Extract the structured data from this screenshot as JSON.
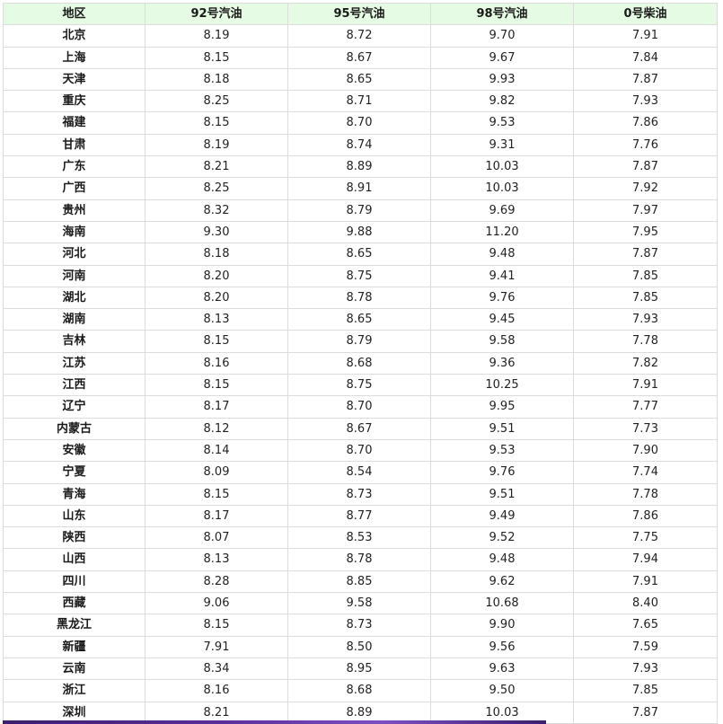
{
  "table": {
    "headers": [
      "地区",
      "92号汽油",
      "95号汽油",
      "98号汽油",
      "0号柴油"
    ],
    "rows": [
      [
        "北京",
        "8.19",
        "8.72",
        "9.70",
        "7.91"
      ],
      [
        "上海",
        "8.15",
        "8.67",
        "9.67",
        "7.84"
      ],
      [
        "天津",
        "8.18",
        "8.65",
        "9.93",
        "7.87"
      ],
      [
        "重庆",
        "8.25",
        "8.71",
        "9.82",
        "7.93"
      ],
      [
        "福建",
        "8.15",
        "8.70",
        "9.53",
        "7.86"
      ],
      [
        "甘肃",
        "8.19",
        "8.74",
        "9.31",
        "7.76"
      ],
      [
        "广东",
        "8.21",
        "8.89",
        "10.03",
        "7.87"
      ],
      [
        "广西",
        "8.25",
        "8.91",
        "10.03",
        "7.92"
      ],
      [
        "贵州",
        "8.32",
        "8.79",
        "9.69",
        "7.97"
      ],
      [
        "海南",
        "9.30",
        "9.88",
        "11.20",
        "7.95"
      ],
      [
        "河北",
        "8.18",
        "8.65",
        "9.48",
        "7.87"
      ],
      [
        "河南",
        "8.20",
        "8.75",
        "9.41",
        "7.85"
      ],
      [
        "湖北",
        "8.20",
        "8.78",
        "9.76",
        "7.85"
      ],
      [
        "湖南",
        "8.13",
        "8.65",
        "9.45",
        "7.93"
      ],
      [
        "吉林",
        "8.15",
        "8.79",
        "9.58",
        "7.78"
      ],
      [
        "江苏",
        "8.16",
        "8.68",
        "9.36",
        "7.82"
      ],
      [
        "江西",
        "8.15",
        "8.75",
        "10.25",
        "7.91"
      ],
      [
        "辽宁",
        "8.17",
        "8.70",
        "9.95",
        "7.77"
      ],
      [
        "内蒙古",
        "8.12",
        "8.67",
        "9.51",
        "7.73"
      ],
      [
        "安徽",
        "8.14",
        "8.70",
        "9.53",
        "7.90"
      ],
      [
        "宁夏",
        "8.09",
        "8.54",
        "9.76",
        "7.74"
      ],
      [
        "青海",
        "8.15",
        "8.73",
        "9.51",
        "7.78"
      ],
      [
        "山东",
        "8.17",
        "8.77",
        "9.49",
        "7.86"
      ],
      [
        "陕西",
        "8.07",
        "8.53",
        "9.52",
        "7.75"
      ],
      [
        "山西",
        "8.13",
        "8.78",
        "9.48",
        "7.94"
      ],
      [
        "四川",
        "8.28",
        "8.85",
        "9.62",
        "7.91"
      ],
      [
        "西藏",
        "9.06",
        "9.58",
        "10.68",
        "8.40"
      ],
      [
        "黑龙江",
        "8.15",
        "8.73",
        "9.90",
        "7.65"
      ],
      [
        "新疆",
        "7.91",
        "8.50",
        "9.56",
        "7.59"
      ],
      [
        "云南",
        "8.34",
        "8.95",
        "9.63",
        "7.93"
      ],
      [
        "浙江",
        "8.16",
        "8.68",
        "9.50",
        "7.85"
      ],
      [
        "深圳",
        "8.21",
        "8.89",
        "10.03",
        "7.87"
      ]
    ]
  },
  "colors": {
    "header_bg": "#e6fbe3",
    "border": "#dcdcdc",
    "bottom_bar": "#5a2e9a"
  }
}
